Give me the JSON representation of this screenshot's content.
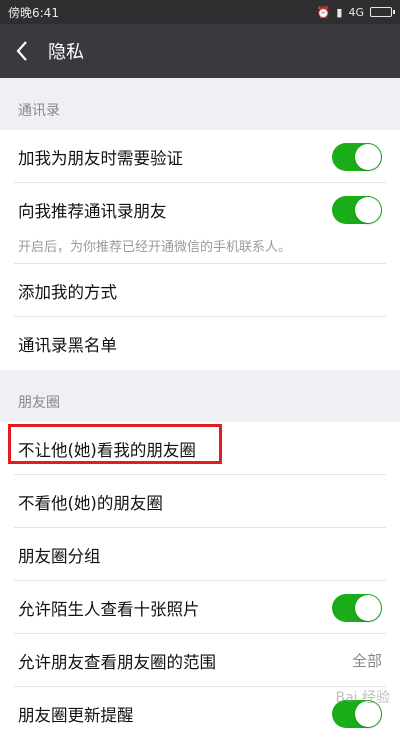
{
  "status_bar": {
    "time": "傍晚6:41",
    "network": "4G"
  },
  "title_bar": {
    "title": "隐私"
  },
  "sections": {
    "contacts": {
      "header": "通讯录",
      "verify_label": "加我为朋友时需要验证",
      "recommend_label": "向我推荐通讯录朋友",
      "recommend_hint": "开启后，为你推荐已经开通微信的手机联系人。",
      "add_methods_label": "添加我的方式",
      "blacklist_label": "通讯录黑名单"
    },
    "moments": {
      "header": "朋友圈",
      "block_others_label": "不让他(她)看我的朋友圈",
      "hide_others_label": "不看他(她)的朋友圈",
      "groups_label": "朋友圈分组",
      "stranger_photos_label": "允许陌生人查看十张照片",
      "friends_range_label": "允许朋友查看朋友圈的范围",
      "friends_range_value": "全部",
      "update_reminder_label": "朋友圈更新提醒"
    }
  },
  "toggles": {
    "verify": true,
    "recommend": true,
    "stranger_photos": true,
    "update_reminder": true
  },
  "colors": {
    "toggle_on": "#1aad19",
    "title_bar": "#393a3e",
    "highlight": "#e01e1e"
  },
  "watermark": "Bai 经验"
}
